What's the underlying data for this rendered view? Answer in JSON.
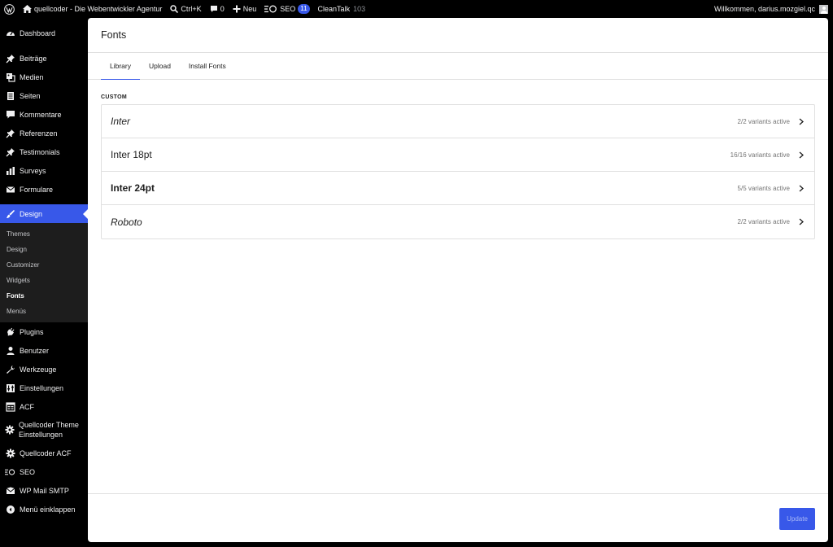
{
  "adminbar": {
    "site_name": "quellcoder - Die Webentwickler Agentur",
    "search_shortcut": "Ctrl+K",
    "comments_count": "0",
    "new_label": "Neu",
    "seo_label": "SEO",
    "seo_count": "11",
    "cleantalk_label": "CleanTalk",
    "cleantalk_count": "103",
    "welcome": "Willkommen, darius.mozgiel.qc"
  },
  "sidebar": {
    "items_top": [
      {
        "label": "Dashboard",
        "icon": "dashboard-icon"
      }
    ],
    "items": [
      {
        "label": "Beiträge",
        "icon": "pin-icon"
      },
      {
        "label": "Medien",
        "icon": "media-icon"
      },
      {
        "label": "Seiten",
        "icon": "page-icon"
      },
      {
        "label": "Kommentare",
        "icon": "comment-icon"
      },
      {
        "label": "Referenzen",
        "icon": "pin-icon"
      },
      {
        "label": "Testimonials",
        "icon": "pin-icon"
      },
      {
        "label": "Surveys",
        "icon": "chart-icon"
      },
      {
        "label": "Formulare",
        "icon": "mail-icon"
      }
    ],
    "active": {
      "label": "Design",
      "icon": "brush-icon"
    },
    "submenu": [
      "Themes",
      "Design",
      "Customizer",
      "Widgets",
      "Fonts",
      "Menüs"
    ],
    "submenu_current": "Fonts",
    "items_bottom": [
      {
        "label": "Plugins",
        "icon": "plugin-icon"
      },
      {
        "label": "Benutzer",
        "icon": "user-icon"
      },
      {
        "label": "Werkzeuge",
        "icon": "wrench-icon"
      },
      {
        "label": "Einstellungen",
        "icon": "settings-icon"
      },
      {
        "label": "ACF",
        "icon": "acf-icon"
      },
      {
        "label": "Quellcoder Theme Einstellungen",
        "icon": "gear-icon",
        "tall": true
      },
      {
        "label": "Quellcoder ACF",
        "icon": "gear-icon"
      },
      {
        "label": "SEO",
        "icon": "seo-icon"
      },
      {
        "label": "WP Mail SMTP",
        "icon": "mail-smtp-icon"
      },
      {
        "label": "Menü einklappen",
        "icon": "collapse-icon"
      }
    ]
  },
  "main": {
    "title": "Fonts",
    "tabs": [
      "Library",
      "Upload",
      "Install Fonts"
    ],
    "selected_tab": "Library",
    "section_label": "CUSTOM",
    "fonts": [
      {
        "name": "Inter",
        "variants": "2/2 variants active",
        "style": "italic"
      },
      {
        "name": "Inter 18pt",
        "variants": "16/16 variants active",
        "style": "normal"
      },
      {
        "name": "Inter 24pt",
        "variants": "5/5 variants active",
        "style": "bold"
      },
      {
        "name": "Roboto",
        "variants": "2/2 variants active",
        "style": "italic"
      }
    ],
    "update_label": "Update"
  },
  "colors": {
    "accent": "#3858e9",
    "sidebar_bg": "#000000",
    "submenu_bg": "#1d1d1d"
  }
}
